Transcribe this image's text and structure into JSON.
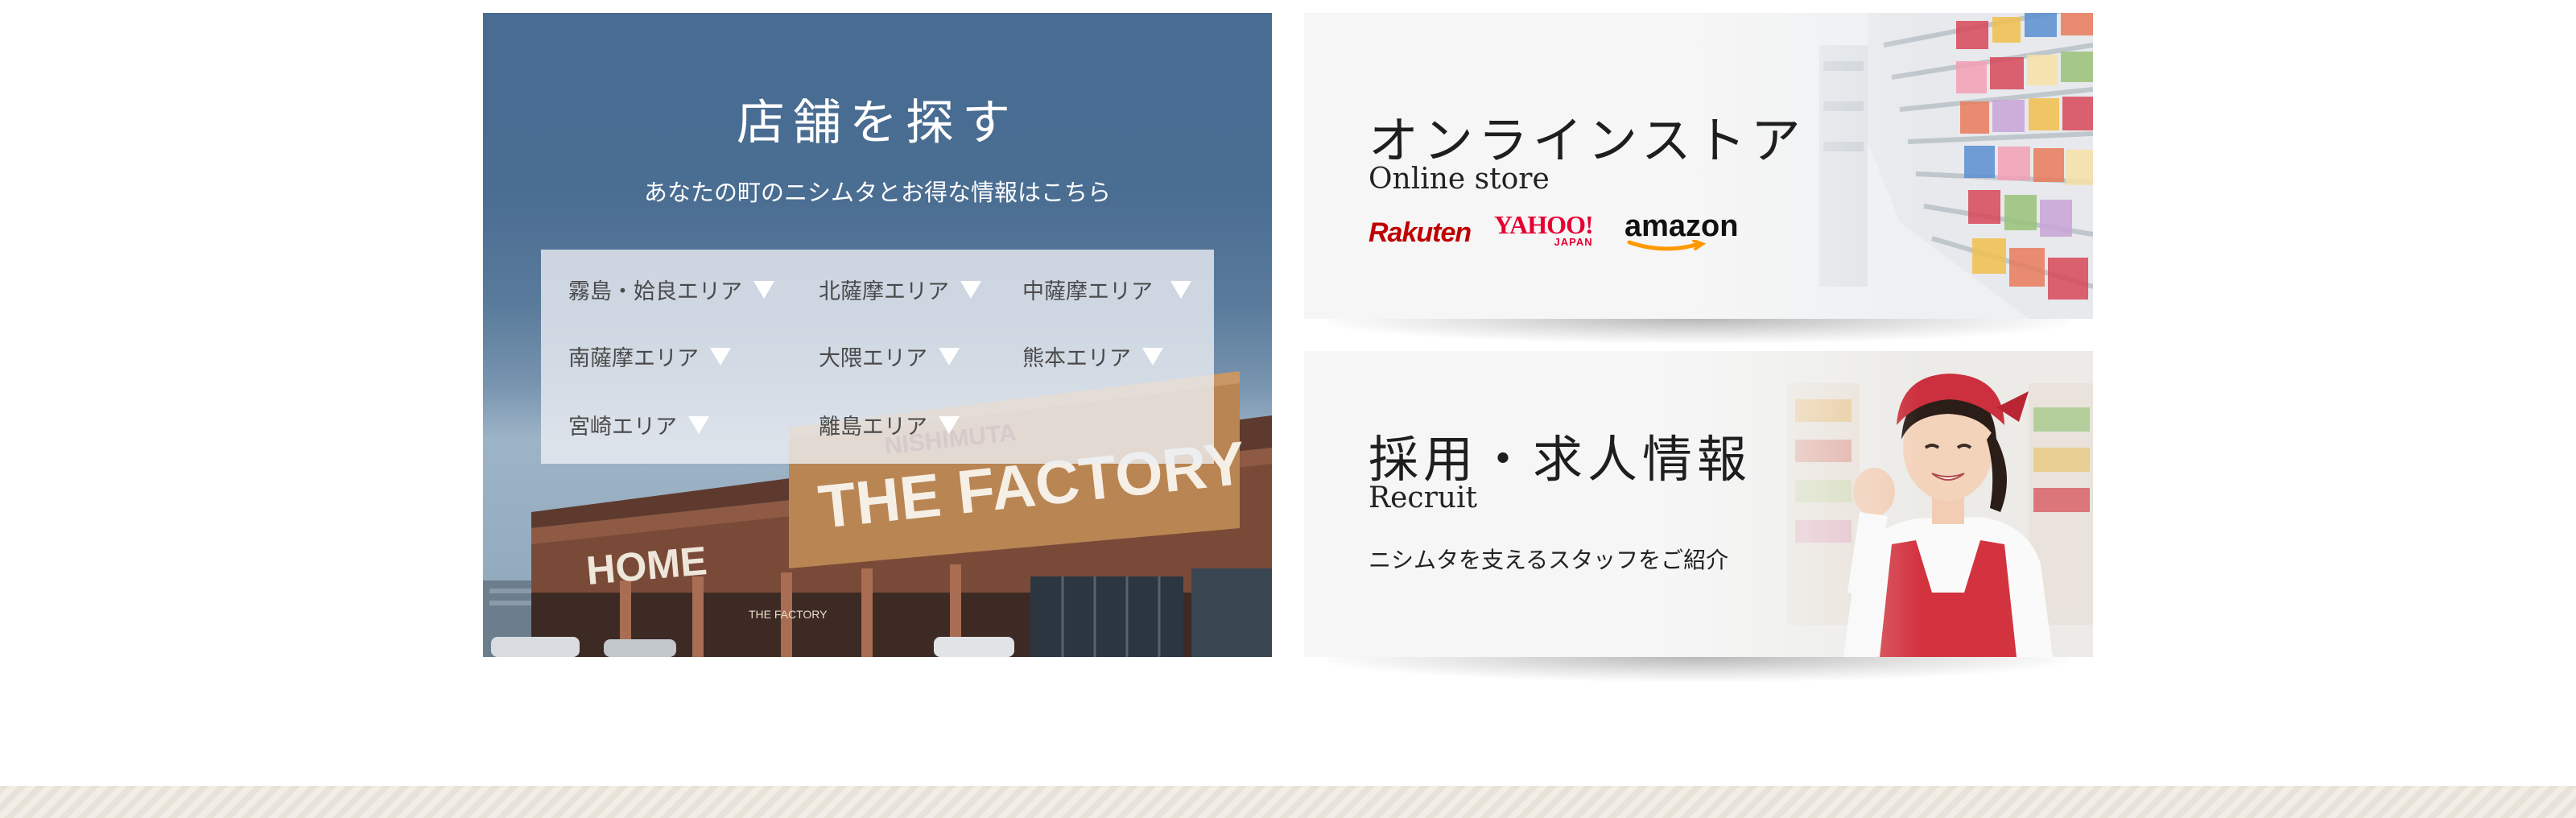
{
  "store_finder": {
    "title": "店舗を探す",
    "subtitle": "あなたの町のニシムタとお得な情報はこちら",
    "areas": [
      {
        "label": "霧島・姶良エリア"
      },
      {
        "label": "北薩摩エリア"
      },
      {
        "label": "中薩摩エリア"
      },
      {
        "label": "南薩摩エリア"
      },
      {
        "label": "大隈エリア"
      },
      {
        "label": "熊本エリア"
      },
      {
        "label": "宮崎エリア"
      },
      {
        "label": "離島エリア"
      }
    ],
    "photo_signs": {
      "factory": "THE FACTORY",
      "nishimuta": "NISHIMUTA",
      "home": "HOME",
      "small": "THE FACTORY"
    },
    "overlay_color": "#486c92"
  },
  "online_store": {
    "title": "オンラインストア",
    "subtitle": "Online store",
    "logos": {
      "rakuten": "Rakuten",
      "yahoo": "YAHOO!",
      "yahoo_sub": "JAPAN",
      "amazon": "amazon"
    },
    "logo_colors": {
      "rakuten": "#bf0000",
      "yahoo": "#e60033",
      "amazon": "#111111",
      "amazon_smile": "#ff9900"
    }
  },
  "recruit": {
    "title": "採用・求人情報",
    "subtitle": "Recruit",
    "description": "ニシムタを支えるスタッフをご紹介"
  }
}
